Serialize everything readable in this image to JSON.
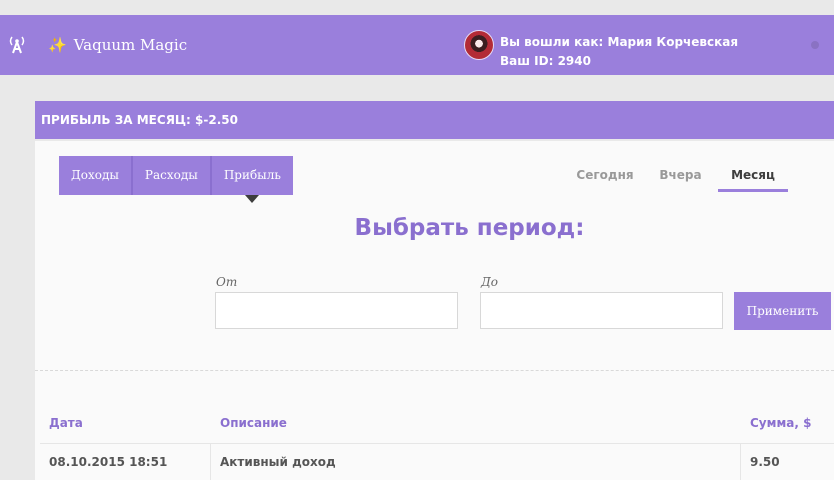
{
  "header": {
    "brand": "Vaquum Magic",
    "user_line1": "Вы вошли как: Мария Корчевская",
    "user_line2": "Ваш ID: 2940",
    "icons": [
      "antenna-icon",
      "wand-icon",
      "avatar",
      "status-dot"
    ]
  },
  "panel": {
    "title": "ПРИБЫЛЬ ЗА МЕСЯЦ: $-2.50",
    "segments": [
      "Доходы",
      "Расходы",
      "Прибыль"
    ],
    "active_segment": "Прибыль",
    "period_tabs": [
      "Сегодня",
      "Вчера",
      "Месяц"
    ],
    "active_tab": "Месяц",
    "heading": "Выбрать период:",
    "from_label": "От",
    "to_label": "До",
    "from_value": "",
    "to_value": "",
    "apply_label": "Применить"
  },
  "table": {
    "columns": [
      "Дата",
      "Описание",
      "Сумма, $"
    ],
    "rows": [
      [
        "08.10.2015 18:51",
        "Активный доход",
        "9.50"
      ]
    ]
  },
  "colors": {
    "accent": "#9a7fdc",
    "heading": "#8a6fcf",
    "background": "#e9e9e9",
    "panel": "#fafafa"
  }
}
